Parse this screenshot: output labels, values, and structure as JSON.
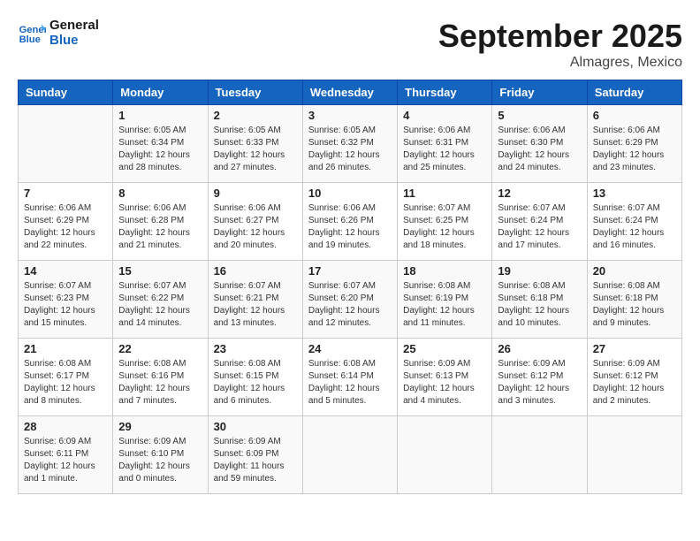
{
  "header": {
    "logo_line1": "General",
    "logo_line2": "Blue",
    "month": "September 2025",
    "location": "Almagres, Mexico"
  },
  "days_of_week": [
    "Sunday",
    "Monday",
    "Tuesday",
    "Wednesday",
    "Thursday",
    "Friday",
    "Saturday"
  ],
  "weeks": [
    [
      {
        "day": "",
        "sunrise": "",
        "sunset": "",
        "daylight": ""
      },
      {
        "day": "1",
        "sunrise": "6:05 AM",
        "sunset": "6:34 PM",
        "daylight": "12 hours and 28 minutes."
      },
      {
        "day": "2",
        "sunrise": "6:05 AM",
        "sunset": "6:33 PM",
        "daylight": "12 hours and 27 minutes."
      },
      {
        "day": "3",
        "sunrise": "6:05 AM",
        "sunset": "6:32 PM",
        "daylight": "12 hours and 26 minutes."
      },
      {
        "day": "4",
        "sunrise": "6:06 AM",
        "sunset": "6:31 PM",
        "daylight": "12 hours and 25 minutes."
      },
      {
        "day": "5",
        "sunrise": "6:06 AM",
        "sunset": "6:30 PM",
        "daylight": "12 hours and 24 minutes."
      },
      {
        "day": "6",
        "sunrise": "6:06 AM",
        "sunset": "6:29 PM",
        "daylight": "12 hours and 23 minutes."
      }
    ],
    [
      {
        "day": "7",
        "sunrise": "6:06 AM",
        "sunset": "6:29 PM",
        "daylight": "12 hours and 22 minutes."
      },
      {
        "day": "8",
        "sunrise": "6:06 AM",
        "sunset": "6:28 PM",
        "daylight": "12 hours and 21 minutes."
      },
      {
        "day": "9",
        "sunrise": "6:06 AM",
        "sunset": "6:27 PM",
        "daylight": "12 hours and 20 minutes."
      },
      {
        "day": "10",
        "sunrise": "6:06 AM",
        "sunset": "6:26 PM",
        "daylight": "12 hours and 19 minutes."
      },
      {
        "day": "11",
        "sunrise": "6:07 AM",
        "sunset": "6:25 PM",
        "daylight": "12 hours and 18 minutes."
      },
      {
        "day": "12",
        "sunrise": "6:07 AM",
        "sunset": "6:24 PM",
        "daylight": "12 hours and 17 minutes."
      },
      {
        "day": "13",
        "sunrise": "6:07 AM",
        "sunset": "6:24 PM",
        "daylight": "12 hours and 16 minutes."
      }
    ],
    [
      {
        "day": "14",
        "sunrise": "6:07 AM",
        "sunset": "6:23 PM",
        "daylight": "12 hours and 15 minutes."
      },
      {
        "day": "15",
        "sunrise": "6:07 AM",
        "sunset": "6:22 PM",
        "daylight": "12 hours and 14 minutes."
      },
      {
        "day": "16",
        "sunrise": "6:07 AM",
        "sunset": "6:21 PM",
        "daylight": "12 hours and 13 minutes."
      },
      {
        "day": "17",
        "sunrise": "6:07 AM",
        "sunset": "6:20 PM",
        "daylight": "12 hours and 12 minutes."
      },
      {
        "day": "18",
        "sunrise": "6:08 AM",
        "sunset": "6:19 PM",
        "daylight": "12 hours and 11 minutes."
      },
      {
        "day": "19",
        "sunrise": "6:08 AM",
        "sunset": "6:18 PM",
        "daylight": "12 hours and 10 minutes."
      },
      {
        "day": "20",
        "sunrise": "6:08 AM",
        "sunset": "6:18 PM",
        "daylight": "12 hours and 9 minutes."
      }
    ],
    [
      {
        "day": "21",
        "sunrise": "6:08 AM",
        "sunset": "6:17 PM",
        "daylight": "12 hours and 8 minutes."
      },
      {
        "day": "22",
        "sunrise": "6:08 AM",
        "sunset": "6:16 PM",
        "daylight": "12 hours and 7 minutes."
      },
      {
        "day": "23",
        "sunrise": "6:08 AM",
        "sunset": "6:15 PM",
        "daylight": "12 hours and 6 minutes."
      },
      {
        "day": "24",
        "sunrise": "6:08 AM",
        "sunset": "6:14 PM",
        "daylight": "12 hours and 5 minutes."
      },
      {
        "day": "25",
        "sunrise": "6:09 AM",
        "sunset": "6:13 PM",
        "daylight": "12 hours and 4 minutes."
      },
      {
        "day": "26",
        "sunrise": "6:09 AM",
        "sunset": "6:12 PM",
        "daylight": "12 hours and 3 minutes."
      },
      {
        "day": "27",
        "sunrise": "6:09 AM",
        "sunset": "6:12 PM",
        "daylight": "12 hours and 2 minutes."
      }
    ],
    [
      {
        "day": "28",
        "sunrise": "6:09 AM",
        "sunset": "6:11 PM",
        "daylight": "12 hours and 1 minute."
      },
      {
        "day": "29",
        "sunrise": "6:09 AM",
        "sunset": "6:10 PM",
        "daylight": "12 hours and 0 minutes."
      },
      {
        "day": "30",
        "sunrise": "6:09 AM",
        "sunset": "6:09 PM",
        "daylight": "11 hours and 59 minutes."
      },
      {
        "day": "",
        "sunrise": "",
        "sunset": "",
        "daylight": ""
      },
      {
        "day": "",
        "sunrise": "",
        "sunset": "",
        "daylight": ""
      },
      {
        "day": "",
        "sunrise": "",
        "sunset": "",
        "daylight": ""
      },
      {
        "day": "",
        "sunrise": "",
        "sunset": "",
        "daylight": ""
      }
    ]
  ]
}
